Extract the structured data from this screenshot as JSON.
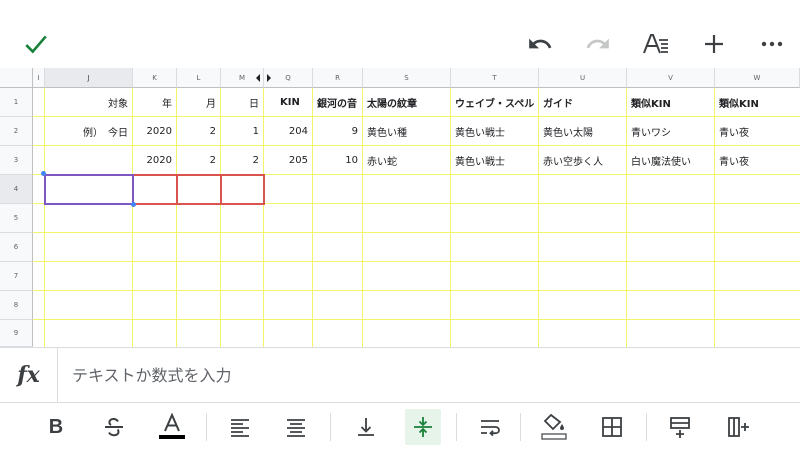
{
  "toolbar": {
    "icons": [
      "check-icon",
      "undo-icon",
      "redo-icon",
      "text-format-icon",
      "plus-icon",
      "more-icon"
    ],
    "accent": "#188038"
  },
  "grid": {
    "columns": [
      {
        "id": "I",
        "label": "I"
      },
      {
        "id": "J",
        "label": "J"
      },
      {
        "id": "K",
        "label": "K"
      },
      {
        "id": "L",
        "label": "L"
      },
      {
        "id": "M",
        "label": "M"
      },
      {
        "id": "Q",
        "label": "Q"
      },
      {
        "id": "R",
        "label": "R"
      },
      {
        "id": "S",
        "label": "S"
      },
      {
        "id": "T",
        "label": "T"
      },
      {
        "id": "U",
        "label": "U"
      },
      {
        "id": "V",
        "label": "V"
      },
      {
        "id": "W",
        "label": "W"
      }
    ],
    "rows": [
      "1",
      "2",
      "3",
      "4",
      "5",
      "6",
      "7",
      "8",
      "9"
    ],
    "selected_cell": "J4",
    "gridline_color": "#f4f46a",
    "cells": {
      "row1": {
        "J": "対象",
        "K": "年",
        "L": "月",
        "M": "日",
        "Q": "KIN",
        "R": "銀河の音",
        "S": "太陽の紋章",
        "T": "ウェイブ・スペル",
        "U": "ガイド",
        "V": "類似KIN",
        "W": "類似KIN"
      },
      "row2": {
        "J": "例）　今日",
        "K": "2020",
        "L": "2",
        "M": "1",
        "Q": "204",
        "R": "9",
        "S": "黄色い種",
        "T": "黄色い戦士",
        "U": "黄色い太陽",
        "V": "青いワシ",
        "W": "青い夜"
      },
      "row3": {
        "K": "2020",
        "L": "2",
        "M": "2",
        "Q": "205",
        "R": "10",
        "S": "赤い蛇",
        "T": "黄色い戦士",
        "U": "赤い空歩く人",
        "V": "白い魔法使い",
        "W": "青い夜"
      }
    }
  },
  "formula_bar": {
    "label": "fx",
    "placeholder": "テキストか数式を入力",
    "value": ""
  },
  "format_toolbar": {
    "bold_label": "B",
    "text_color": "#000000",
    "active_tool": "vertical-align-middle",
    "active_bg": "#e6f4ea"
  }
}
